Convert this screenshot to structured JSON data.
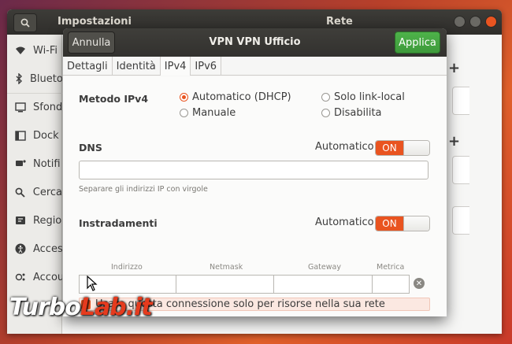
{
  "background_window": {
    "title_left": "Impostazioni",
    "title_right": "Rete",
    "sidebar_items": [
      {
        "label": "Wi-Fi",
        "icon": "wifi-icon"
      },
      {
        "label": "Blueto",
        "icon": "bluetooth-icon"
      },
      {
        "label": "Sfond",
        "icon": "background-icon"
      },
      {
        "label": "Dock",
        "icon": "dock-icon"
      },
      {
        "label": "Notifi",
        "icon": "notifications-icon"
      },
      {
        "label": "Cerca",
        "icon": "search-icon"
      },
      {
        "label": "Regio",
        "icon": "region-icon"
      },
      {
        "label": "Acces",
        "icon": "accessibility-icon"
      },
      {
        "label": "Accou",
        "icon": "accounts-icon"
      }
    ]
  },
  "dialog": {
    "cancel_label": "Annulla",
    "title": "VPN VPN Ufficio",
    "apply_label": "Applica",
    "tabs": [
      "Dettagli",
      "Identità",
      "IPv4",
      "IPv6"
    ],
    "active_tab": "IPv4",
    "method": {
      "label": "Metodo IPv4",
      "options": [
        "Automatico (DHCP)",
        "Solo link-local",
        "Manuale",
        "Disabilita"
      ],
      "selected": "Automatico (DHCP)"
    },
    "dns": {
      "label": "DNS",
      "auto_label": "Automatico",
      "switch_label": "ON",
      "value": "",
      "hint": "Separare gli indirizzi IP con virgole"
    },
    "routes": {
      "label": "Instradamenti",
      "auto_label": "Automatico",
      "switch_label": "ON",
      "columns": [
        "Indirizzo",
        "Netmask",
        "Gateway",
        "Metrica"
      ]
    },
    "only_local_checkbox": {
      "label": "Usare questa connessione solo per risorse nella sua rete",
      "checked": true
    }
  },
  "watermark": {
    "part1": "Turbo",
    "part2": "Lab.it"
  },
  "colors": {
    "accent": "#e95420",
    "apply": "#3e9a3b"
  }
}
